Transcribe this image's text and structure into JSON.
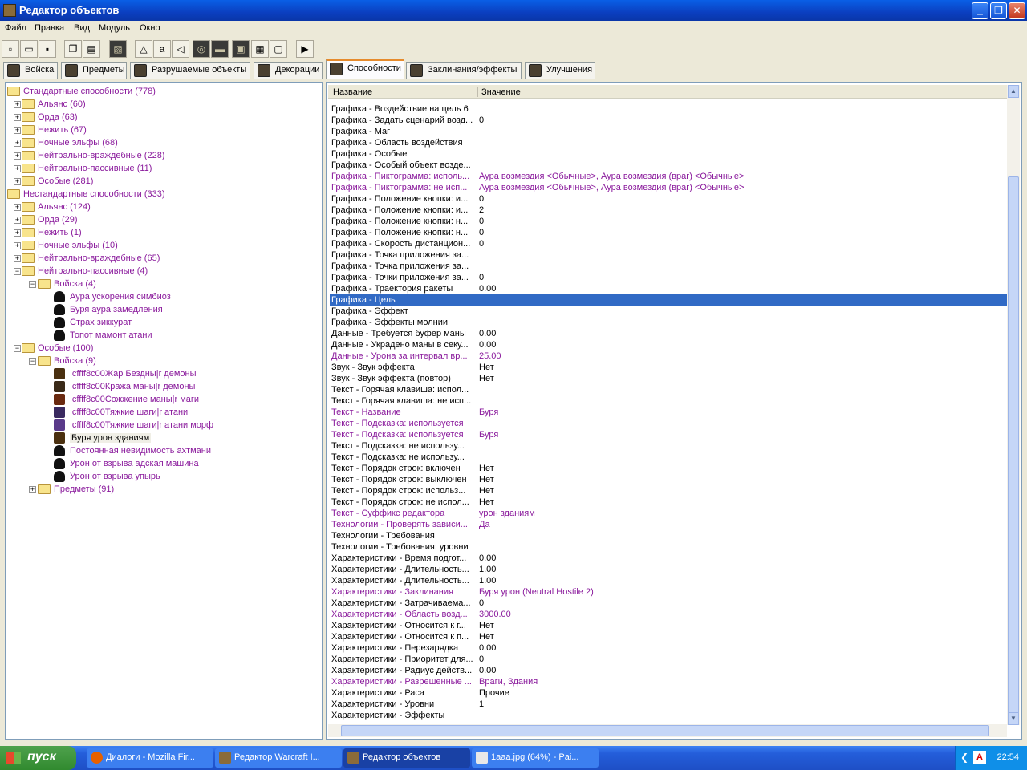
{
  "window": {
    "title": "Редактор объектов"
  },
  "menu": [
    "Файл",
    "Правка",
    "Вид",
    "Модуль",
    "Окно"
  ],
  "tabs": [
    {
      "label": "Войска",
      "active": false
    },
    {
      "label": "Предметы",
      "active": false
    },
    {
      "label": "Разрушаемые объекты",
      "active": false
    },
    {
      "label": "Декорации",
      "active": false
    },
    {
      "label": "Способности",
      "active": true
    },
    {
      "label": "Заклинания/эффекты",
      "active": false
    },
    {
      "label": "Улучшения",
      "active": false
    }
  ],
  "tree": [
    {
      "label": "Стандартные способности (778)",
      "level": 0,
      "kind": "open-folder"
    },
    {
      "label": "Альянс (60)",
      "level": 1,
      "kind": "folder"
    },
    {
      "label": "Орда (63)",
      "level": 1,
      "kind": "folder"
    },
    {
      "label": "Нежить (67)",
      "level": 1,
      "kind": "folder"
    },
    {
      "label": "Ночные эльфы (68)",
      "level": 1,
      "kind": "folder"
    },
    {
      "label": "Нейтрально-враждебные (228)",
      "level": 1,
      "kind": "folder"
    },
    {
      "label": "Нейтрально-пассивные (11)",
      "level": 1,
      "kind": "folder"
    },
    {
      "label": "Особые (281)",
      "level": 1,
      "kind": "folder"
    },
    {
      "label": "Нестандартные способности (333)",
      "level": 0,
      "kind": "open-folder"
    },
    {
      "label": "Альянс (124)",
      "level": 1,
      "kind": "folder"
    },
    {
      "label": "Орда (29)",
      "level": 1,
      "kind": "folder"
    },
    {
      "label": "Нежить (1)",
      "level": 1,
      "kind": "folder"
    },
    {
      "label": "Ночные эльфы (10)",
      "level": 1,
      "kind": "folder"
    },
    {
      "label": "Нейтрально-враждебные (65)",
      "level": 1,
      "kind": "folder"
    },
    {
      "label": "Нейтрально-пассивные (4)",
      "level": 1,
      "kind": "open-folder"
    },
    {
      "label": "Войска (4)",
      "level": 2,
      "kind": "open-folder"
    },
    {
      "label": "Аура ускорения симбиоз",
      "level": 3,
      "kind": "skull"
    },
    {
      "label": "Буря аура замедления",
      "level": 3,
      "kind": "skull"
    },
    {
      "label": "Страх зиккурат",
      "level": 3,
      "kind": "skull"
    },
    {
      "label": "Топот мамонт атани",
      "level": 3,
      "kind": "skull"
    },
    {
      "label": "Особые (100)",
      "level": 1,
      "kind": "open-folder"
    },
    {
      "label": "Войска (9)",
      "level": 2,
      "kind": "open-folder"
    },
    {
      "label": "|cffff8c00Жар Бездны|r демоны",
      "level": 3,
      "kind": "icon"
    },
    {
      "label": "|cffff8c00Кража маны|r демоны",
      "level": 3,
      "kind": "icon"
    },
    {
      "label": "|cffff8c00Сожжение маны|r маги",
      "level": 3,
      "kind": "icon"
    },
    {
      "label": "|cffff8c00Тяжкие шаги|r атани",
      "level": 3,
      "kind": "icon"
    },
    {
      "label": "|cffff8c00Тяжкие шаги|r атани морф",
      "level": 3,
      "kind": "icon"
    },
    {
      "label": "Буря урон зданиям",
      "level": 3,
      "kind": "icon",
      "selected": true
    },
    {
      "label": "Постоянная невидимость ахтмани",
      "level": 3,
      "kind": "skull"
    },
    {
      "label": "Урон от взрыва адская машина",
      "level": 3,
      "kind": "skull"
    },
    {
      "label": "Урон от взрыва упырь",
      "level": 3,
      "kind": "skull"
    },
    {
      "label": "Предметы (91)",
      "level": 2,
      "kind": "folder"
    }
  ],
  "grid": {
    "col_name": "Название",
    "col_value": "Значение",
    "rows": [
      {
        "n": "Графика - Воздействие на цель 6",
        "v": ""
      },
      {
        "n": "Графика - Задать сценарий возд...",
        "v": "0"
      },
      {
        "n": "Графика - Маг",
        "v": ""
      },
      {
        "n": "Графика - Область воздействия",
        "v": ""
      },
      {
        "n": "Графика - Особые",
        "v": ""
      },
      {
        "n": "Графика - Особый объект возде...",
        "v": ""
      },
      {
        "n": "Графика - Пиктограмма: исполь...",
        "v": "Аура возмездия <Обычные>, Аура возмездия (враг) <Обычные>",
        "m": true
      },
      {
        "n": "Графика - Пиктограмма: не исп...",
        "v": "Аура возмездия <Обычные>, Аура возмездия (враг) <Обычные>",
        "m": true
      },
      {
        "n": "Графика - Положение кнопки: и...",
        "v": "0"
      },
      {
        "n": "Графика - Положение кнопки: и...",
        "v": "2"
      },
      {
        "n": "Графика - Положение кнопки: н...",
        "v": "0"
      },
      {
        "n": "Графика - Положение кнопки: н...",
        "v": "0"
      },
      {
        "n": "Графика - Скорость дистанцион...",
        "v": "0"
      },
      {
        "n": "Графика - Точка приложения за...",
        "v": ""
      },
      {
        "n": "Графика - Точка приложения за...",
        "v": ""
      },
      {
        "n": "Графика - Точки приложения за...",
        "v": "0"
      },
      {
        "n": "Графика - Траектория ракеты",
        "v": "0.00"
      },
      {
        "n": "Графика - Цель",
        "v": "",
        "s": true
      },
      {
        "n": "Графика - Эффект",
        "v": ""
      },
      {
        "n": "Графика - Эффекты молнии",
        "v": ""
      },
      {
        "n": "Данные - Требуется буфер маны",
        "v": "0.00"
      },
      {
        "n": "Данные - Украдено маны в секу...",
        "v": "0.00"
      },
      {
        "n": "Данные - Урона за интервал вр...",
        "v": "25.00",
        "m": true
      },
      {
        "n": "Звук - Звук эффекта",
        "v": "Нет"
      },
      {
        "n": "Звук - Звук эффекта (повтор)",
        "v": "Нет"
      },
      {
        "n": "Текст - Горячая клавиша: испол...",
        "v": ""
      },
      {
        "n": "Текст - Горячая клавиша: не исп...",
        "v": ""
      },
      {
        "n": "Текст - Название",
        "v": "Буря",
        "m": true
      },
      {
        "n": "Текст - Подсказка: используется",
        "v": "",
        "m": true
      },
      {
        "n": "Текст - Подсказка: используется",
        "v": "Буря",
        "m": true
      },
      {
        "n": "Текст - Подсказка: не использу...",
        "v": ""
      },
      {
        "n": "Текст - Подсказка: не использу...",
        "v": ""
      },
      {
        "n": "Текст - Порядок строк: включен",
        "v": "Нет"
      },
      {
        "n": "Текст - Порядок строк: выключен",
        "v": "Нет"
      },
      {
        "n": "Текст - Порядок строк: использ...",
        "v": "Нет"
      },
      {
        "n": "Текст - Порядок строк: не испол...",
        "v": "Нет"
      },
      {
        "n": "Текст - Суффикс редактора",
        "v": "урон зданиям",
        "m": true
      },
      {
        "n": "Технологии - Проверять зависи...",
        "v": "Да",
        "m": true
      },
      {
        "n": "Технологии - Требования",
        "v": ""
      },
      {
        "n": "Технологии - Требования: уровни",
        "v": ""
      },
      {
        "n": "Характеристики - Время подгот...",
        "v": "0.00"
      },
      {
        "n": "Характеристики - Длительность...",
        "v": "1.00"
      },
      {
        "n": "Характеристики - Длительность...",
        "v": "1.00"
      },
      {
        "n": "Характеристики - Заклинания",
        "v": "Буря урон (Neutral Hostile 2)",
        "m": true
      },
      {
        "n": "Характеристики - Затрачиваема...",
        "v": "0"
      },
      {
        "n": "Характеристики - Область возд...",
        "v": "3000.00",
        "m": true
      },
      {
        "n": "Характеристики - Относится к г...",
        "v": "Нет"
      },
      {
        "n": "Характеристики - Относится к п...",
        "v": "Нет"
      },
      {
        "n": "Характеристики - Перезарядка",
        "v": "0.00"
      },
      {
        "n": "Характеристики - Приоритет для...",
        "v": "0"
      },
      {
        "n": "Характеристики - Радиус действ...",
        "v": "0.00"
      },
      {
        "n": "Характеристики - Разрешенные ...",
        "v": "Враги, Здания",
        "m": true
      },
      {
        "n": "Характеристики - Раса",
        "v": "Прочие"
      },
      {
        "n": "Характеристики - Уровни",
        "v": "1"
      },
      {
        "n": "Характеристики - Эффекты",
        "v": ""
      }
    ]
  },
  "taskbar": {
    "start": "пуск",
    "tasks": [
      {
        "label": "Диалоги - Mozilla Fir...",
        "active": false
      },
      {
        "label": "Редактор Warcraft I...",
        "active": false
      },
      {
        "label": "Редактор объектов",
        "active": true
      },
      {
        "label": "1aaa.jpg (64%) - Pai...",
        "active": false
      }
    ],
    "clock": "22:54"
  },
  "colors": {
    "modified": "#8a1a9c",
    "selection": "#316ac5",
    "tab_highlight": "#e68b2c"
  }
}
